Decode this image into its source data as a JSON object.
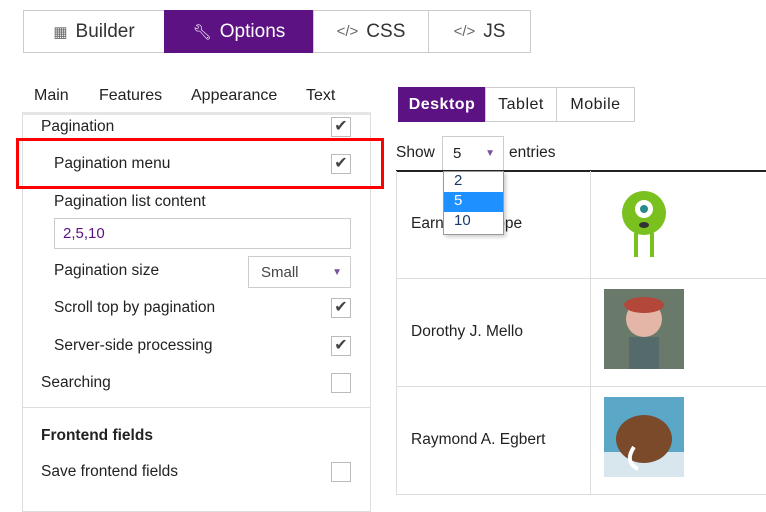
{
  "top_tabs": [
    {
      "label": "Builder",
      "icon": "grid-icon"
    },
    {
      "label": "Options",
      "icon": "wrench-icon"
    },
    {
      "label": "CSS",
      "icon": "code-icon"
    },
    {
      "label": "JS",
      "icon": "code-icon"
    }
  ],
  "active_top_tab": "Options",
  "sub_tabs": [
    "Main",
    "Features",
    "Appearance",
    "Text"
  ],
  "active_sub_tab": "Features",
  "features": {
    "pagination": {
      "label": "Pagination",
      "checked": true
    },
    "pagination_menu": {
      "label": "Pagination menu",
      "checked": true
    },
    "pagination_list_content": {
      "label": "Pagination list content",
      "value": "2,5,10"
    },
    "pagination_size": {
      "label": "Pagination size",
      "value": "Small"
    },
    "scroll_top": {
      "label": "Scroll top by pagination",
      "checked": true
    },
    "server_side": {
      "label": "Server-side processing",
      "checked": true
    },
    "searching": {
      "label": "Searching",
      "checked": false
    },
    "frontend_heading": "Frontend fields",
    "save_frontend": {
      "label": "Save frontend fields",
      "checked": false
    }
  },
  "device_tabs": [
    "Desktop",
    "Tablet",
    "Mobile"
  ],
  "active_device": "Desktop",
  "preview": {
    "show_label": "Show",
    "entries_label": "entries",
    "selected": "5",
    "options": [
      "2",
      "5",
      "10"
    ],
    "rows": [
      {
        "name": "Earnest L. Pope"
      },
      {
        "name": "Dorothy J. Mello"
      },
      {
        "name": "Raymond A. Egbert"
      }
    ]
  },
  "colors": {
    "accent": "#5c1282",
    "highlight": "#ff0000",
    "selected_option": "#1e90ff"
  }
}
